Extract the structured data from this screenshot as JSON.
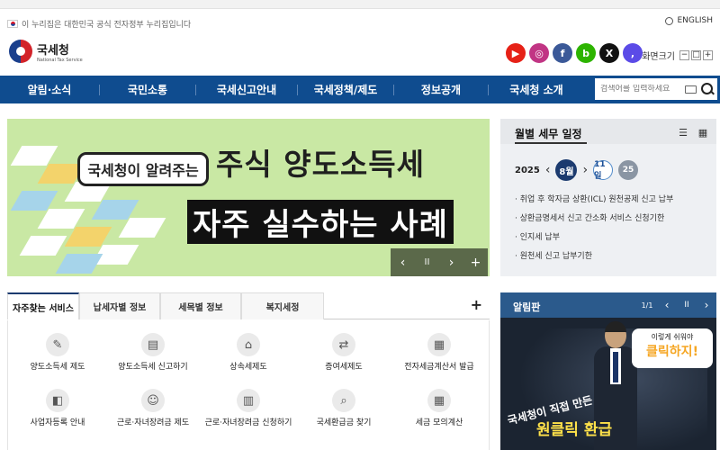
{
  "top": {
    "gov_notice": "이 누리집은 대한민국 공식 전자정부 누리집입니다",
    "language": "ENGLISH"
  },
  "logo": {
    "name_ko": "국세청",
    "name_en": "National Tax Service"
  },
  "social": [
    {
      "icon": "youtube-icon",
      "glyph": "▶",
      "color": "#e62117"
    },
    {
      "icon": "instagram-icon",
      "glyph": "◎",
      "color": "#c13584"
    },
    {
      "icon": "facebook-icon",
      "glyph": "f",
      "color": "#3b5998"
    },
    {
      "icon": "blog-icon",
      "glyph": "b",
      "color": "#2db400"
    },
    {
      "icon": "x-icon",
      "glyph": "X",
      "color": "#111111"
    },
    {
      "icon": "comma-icon",
      "glyph": ",",
      "color": "#5b4be7"
    }
  ],
  "fontsize": {
    "label": "화면크기",
    "minus": "−",
    "reset": "□",
    "plus": "+"
  },
  "gnb": {
    "items": [
      "알림·소식",
      "국민소통",
      "국세신고안내",
      "국세정책/제도",
      "정보공개",
      "국세청 소개"
    ]
  },
  "search": {
    "placeholder": "검색어를 입력하세요"
  },
  "banner": {
    "bubble": "국세청이 알려주는",
    "title_line1": "주식 양도소득세",
    "title_line2": "자주 실수하는 사례",
    "controls": {
      "prev": "‹",
      "pause": "II",
      "next": "›",
      "more": "+"
    }
  },
  "schedule": {
    "title": "월별 세무 일정",
    "year": "2025",
    "month": "8월",
    "prev": "‹",
    "next": "›",
    "days": [
      "11일",
      "25"
    ],
    "items": [
      "취업 후 학자금 상환(ICL) 원천공제 신고 납부",
      "상환금명세서 신고 간소화 서비스 신청기한",
      "인지세 납부",
      "원천세 신고 납부기한"
    ]
  },
  "tabs": {
    "items": [
      "자주찾는 서비스",
      "납세자별 정보",
      "세목별 정보",
      "복지세정"
    ],
    "plus": "+"
  },
  "services": [
    {
      "label": "양도소득세 제도",
      "icon": "document-pen-icon",
      "glyph": "✎"
    },
    {
      "label": "양도소득세 신고하기",
      "icon": "form-icon",
      "glyph": "▤"
    },
    {
      "label": "상속세제도",
      "icon": "inheritance-icon",
      "glyph": "⌂"
    },
    {
      "label": "증여세제도",
      "icon": "gift-icon",
      "glyph": "⇄"
    },
    {
      "label": "전자세금계산서 발급",
      "icon": "calculator-icon",
      "glyph": "▦"
    },
    {
      "label": "사업자등록 안내",
      "icon": "id-card-icon",
      "glyph": "◧"
    },
    {
      "label": "근로·자녀장려금 제도",
      "icon": "worker-icon",
      "glyph": "☺"
    },
    {
      "label": "근로·자녀장려금 신청하기",
      "icon": "application-icon",
      "glyph": "▥"
    },
    {
      "label": "국세환급금 찾기",
      "icon": "search-refund-icon",
      "glyph": "⌕"
    },
    {
      "label": "세금 모의계산",
      "icon": "simulation-icon",
      "glyph": "▦"
    }
  ],
  "notice": {
    "title": "알림판",
    "page": "1/1",
    "prev": "‹",
    "pause": "II",
    "next": "›",
    "speech_small": "이렇게 쉬워야",
    "speech_big": "클릭하지!",
    "caption1": "국세청이 직접 만든",
    "caption2": "원클릭 환급"
  }
}
